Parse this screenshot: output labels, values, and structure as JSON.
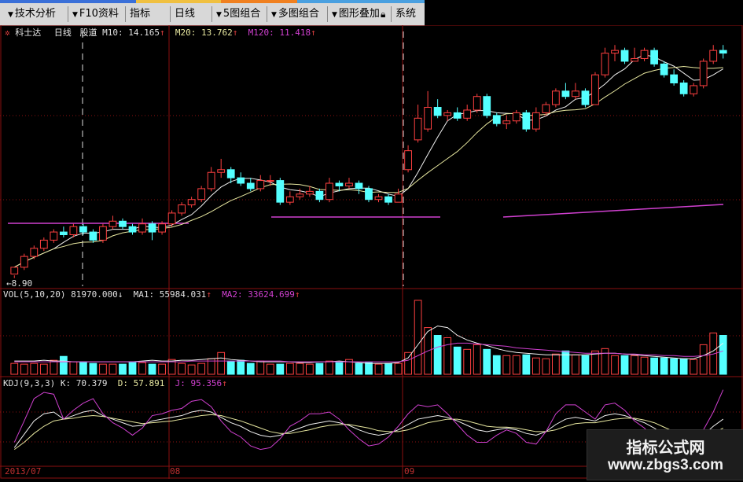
{
  "toolbar": {
    "items": [
      {
        "label": "技术分析",
        "dropdown": true
      },
      {
        "label": "F10资料",
        "dropdown": true
      },
      {
        "label": "指标",
        "dropdown": false
      },
      {
        "label": "日线",
        "dropdown": false
      },
      {
        "label": "5图组合",
        "dropdown": true
      },
      {
        "label": "多图组合",
        "dropdown": true
      },
      {
        "label": "图形叠加",
        "dropdown": true
      },
      {
        "label": "系统",
        "dropdown": false
      }
    ],
    "lock_icon": "lock-icon"
  },
  "price_panel": {
    "stock_name": "科士达",
    "period": "日线",
    "indicator_name": "股道",
    "m10": "M10: 14.165",
    "m20": "M20: 13.762",
    "m120": "M120: 11.418",
    "low_label": "8.90",
    "arrows": "↑"
  },
  "vol_panel": {
    "label": "VOL(5,10,20)",
    "vol": "81970.000",
    "vol_arrow": "↓",
    "ma1": "MA1: 55984.031",
    "ma2": "MA2: 33624.699",
    "arrow_up": "↑"
  },
  "kdj_panel": {
    "label": "KDJ(9,3,3)",
    "k": "K: 70.379",
    "d": "D: 57.891",
    "j": "J: 95.356",
    "arrow_up": "↑"
  },
  "date_axis": [
    "2013/07",
    "08",
    "09"
  ],
  "watermark": {
    "line1": "指标公式网",
    "line2": "www.zbgs3.com"
  },
  "colors": {
    "up": "#ff4040",
    "down": "#54ffff",
    "ma_white": "#f0f0f0",
    "ma_yellow": "#e8e8a0",
    "ma_magenta": "#d040d0",
    "grid": "#8b1010"
  },
  "chart_data": {
    "type": "candlestick",
    "candles": [
      [
        9.05,
        9.3,
        9.0,
        8.9
      ],
      [
        9.3,
        9.7,
        9.8,
        9.2
      ],
      [
        9.7,
        10.0,
        10.1,
        9.6
      ],
      [
        10.0,
        10.3,
        10.4,
        9.9
      ],
      [
        10.3,
        10.6,
        10.7,
        10.2
      ],
      [
        10.6,
        10.5,
        10.8,
        10.4
      ],
      [
        10.5,
        10.8,
        10.9,
        10.4
      ],
      [
        10.8,
        10.6,
        10.9,
        10.5
      ],
      [
        10.6,
        10.3,
        10.7,
        10.2
      ],
      [
        10.3,
        10.8,
        10.9,
        10.2
      ],
      [
        10.8,
        11.0,
        11.2,
        10.7
      ],
      [
        11.0,
        10.8,
        11.1,
        10.7
      ],
      [
        10.8,
        10.6,
        10.9,
        10.5
      ],
      [
        10.6,
        10.9,
        11.1,
        10.5
      ],
      [
        10.9,
        10.6,
        11.0,
        10.3
      ],
      [
        10.6,
        10.9,
        11.0,
        10.5
      ],
      [
        10.9,
        11.3,
        11.4,
        10.8
      ],
      [
        11.3,
        11.6,
        11.7,
        11.2
      ],
      [
        11.6,
        11.8,
        11.9,
        11.5
      ],
      [
        11.8,
        12.2,
        12.3,
        11.7
      ],
      [
        12.2,
        12.8,
        13.0,
        12.1
      ],
      [
        12.8,
        12.9,
        13.3,
        12.6
      ],
      [
        12.9,
        12.6,
        13.0,
        12.4
      ],
      [
        12.6,
        12.4,
        12.8,
        12.3
      ],
      [
        12.4,
        12.2,
        12.6,
        12.1
      ],
      [
        12.2,
        12.5,
        12.7,
        12.1
      ],
      [
        12.5,
        12.5,
        12.7,
        12.3
      ],
      [
        12.5,
        11.7,
        12.6,
        11.6
      ],
      [
        11.7,
        11.9,
        12.1,
        11.6
      ],
      [
        11.9,
        12.0,
        12.2,
        11.8
      ],
      [
        12.0,
        12.1,
        12.3,
        11.9
      ],
      [
        12.1,
        11.8,
        12.2,
        11.7
      ],
      [
        11.8,
        12.4,
        12.6,
        11.7
      ],
      [
        12.4,
        12.3,
        12.5,
        12.1
      ],
      [
        12.3,
        12.4,
        12.6,
        12.2
      ],
      [
        12.4,
        12.2,
        12.5,
        12.0
      ],
      [
        12.2,
        11.8,
        12.3,
        11.7
      ],
      [
        11.8,
        11.9,
        12.0,
        11.7
      ],
      [
        11.9,
        11.7,
        12.0,
        11.6
      ],
      [
        11.7,
        12.0,
        12.2,
        11.7
      ],
      [
        12.9,
        13.6,
        13.8,
        12.8
      ],
      [
        14.0,
        14.8,
        15.3,
        13.9
      ],
      [
        14.4,
        15.2,
        15.8,
        14.3
      ],
      [
        15.2,
        14.9,
        15.5,
        14.8
      ],
      [
        14.9,
        15.0,
        15.1,
        14.7
      ],
      [
        15.0,
        14.8,
        15.2,
        14.7
      ],
      [
        14.8,
        15.1,
        15.3,
        14.7
      ],
      [
        15.1,
        15.6,
        15.7,
        15.0
      ],
      [
        15.6,
        14.9,
        15.7,
        14.8
      ],
      [
        14.9,
        14.6,
        15.0,
        14.5
      ],
      [
        14.6,
        14.7,
        14.9,
        14.4
      ],
      [
        14.7,
        15.0,
        15.1,
        14.6
      ],
      [
        15.0,
        14.4,
        15.1,
        14.3
      ],
      [
        14.4,
        15.0,
        15.2,
        14.3
      ],
      [
        15.0,
        15.3,
        15.4,
        14.9
      ],
      [
        15.3,
        15.8,
        15.9,
        15.2
      ],
      [
        15.8,
        15.6,
        16.1,
        15.5
      ],
      [
        15.6,
        15.8,
        16.1,
        15.5
      ],
      [
        15.8,
        15.3,
        15.9,
        15.2
      ],
      [
        15.3,
        16.4,
        16.5,
        15.3
      ],
      [
        16.4,
        17.2,
        17.4,
        16.3
      ],
      [
        17.2,
        17.3,
        17.5,
        16.9
      ],
      [
        17.3,
        16.9,
        17.4,
        16.8
      ],
      [
        16.9,
        17.0,
        17.4,
        16.9
      ],
      [
        17.0,
        17.3,
        17.4,
        16.9
      ],
      [
        17.3,
        16.8,
        17.4,
        16.7
      ],
      [
        16.8,
        16.4,
        16.9,
        16.3
      ],
      [
        16.4,
        16.1,
        16.6,
        16.0
      ],
      [
        16.1,
        15.7,
        16.2,
        15.6
      ],
      [
        15.7,
        16.0,
        16.1,
        15.6
      ],
      [
        16.0,
        16.9,
        17.0,
        15.9
      ],
      [
        16.9,
        17.3,
        17.5,
        16.8
      ],
      [
        17.3,
        17.2,
        17.5,
        17.0
      ]
    ],
    "volume": [
      14,
      13,
      14,
      13,
      18,
      23,
      16,
      16,
      14,
      13,
      13,
      13,
      16,
      15,
      13,
      13,
      19,
      14,
      12,
      14,
      20,
      28,
      17,
      18,
      14,
      17,
      13,
      13,
      14,
      14,
      13,
      14,
      17,
      15,
      19,
      14,
      15,
      13,
      14,
      14,
      28,
      95,
      60,
      50,
      47,
      35,
      32,
      38,
      32,
      24,
      24,
      24,
      25,
      21,
      20,
      26,
      30,
      25,
      24,
      30,
      33,
      24,
      24,
      24,
      22,
      21,
      21,
      20,
      20,
      19,
      38,
      53,
      50
    ],
    "ma_vol1": [
      17,
      17,
      17,
      18,
      17,
      17,
      16,
      16,
      16,
      16,
      16,
      16,
      16,
      17,
      18,
      17,
      17,
      18,
      18,
      19,
      20,
      21,
      19,
      18,
      17,
      16,
      16,
      16,
      16,
      15,
      15,
      16,
      16,
      17,
      16,
      15,
      14,
      14,
      14,
      15,
      21,
      38,
      55,
      62,
      60,
      50,
      44,
      40,
      37,
      33,
      30,
      28,
      27,
      26,
      25,
      25,
      25,
      25,
      25,
      26,
      27,
      27,
      26,
      25,
      24,
      23,
      22,
      21,
      20,
      20,
      24,
      30,
      40
    ],
    "ma_vol2": [
      16,
      16,
      16,
      16,
      16,
      16,
      16,
      16,
      16,
      16,
      16,
      16,
      16,
      16,
      16,
      16,
      16,
      16,
      17,
      17,
      17,
      17,
      17,
      17,
      17,
      17,
      17,
      17,
      16,
      16,
      16,
      16,
      16,
      16,
      16,
      16,
      16,
      16,
      16,
      16,
      18,
      24,
      30,
      35,
      38,
      40,
      40,
      39,
      38,
      37,
      36,
      34,
      33,
      32,
      31,
      30,
      29,
      28,
      27,
      27,
      27,
      27,
      26,
      26,
      25,
      25,
      24,
      24,
      23,
      23,
      24,
      26,
      30
    ],
    "kdj_k": [
      30,
      45,
      60,
      68,
      70,
      62,
      66,
      70,
      72,
      66,
      62,
      58,
      54,
      55,
      60,
      62,
      64,
      66,
      70,
      72,
      70,
      64,
      58,
      54,
      48,
      44,
      42,
      44,
      48,
      52,
      56,
      58,
      60,
      58,
      55,
      50,
      46,
      44,
      46,
      50,
      56,
      62,
      64,
      66,
      64,
      60,
      55,
      50,
      48,
      50,
      52,
      50,
      46,
      44,
      48,
      56,
      62,
      64,
      62,
      60,
      66,
      68,
      66,
      62,
      58,
      52,
      44,
      38,
      34,
      36,
      44,
      54,
      62
    ],
    "kdj_d": [
      28,
      36,
      46,
      54,
      60,
      62,
      63,
      65,
      66,
      65,
      63,
      61,
      59,
      57,
      58,
      59,
      60,
      62,
      64,
      66,
      67,
      66,
      63,
      60,
      56,
      52,
      48,
      46,
      46,
      48,
      50,
      53,
      55,
      56,
      56,
      54,
      52,
      49,
      48,
      48,
      50,
      54,
      58,
      60,
      62,
      62,
      60,
      57,
      54,
      53,
      53,
      52,
      50,
      48,
      48,
      50,
      54,
      57,
      58,
      58,
      60,
      62,
      63,
      63,
      61,
      58,
      53,
      48,
      43,
      40,
      41,
      46,
      52
    ],
    "kdj_j": [
      36,
      60,
      85,
      92,
      90,
      62,
      72,
      80,
      85,
      68,
      58,
      52,
      44,
      52,
      66,
      68,
      72,
      74,
      82,
      84,
      76,
      60,
      48,
      42,
      32,
      28,
      30,
      40,
      54,
      60,
      68,
      68,
      70,
      62,
      50,
      40,
      32,
      34,
      42,
      54,
      68,
      78,
      76,
      78,
      68,
      56,
      44,
      36,
      36,
      44,
      50,
      46,
      36,
      34,
      48,
      68,
      78,
      78,
      70,
      62,
      78,
      80,
      72,
      60,
      52,
      40,
      26,
      20,
      16,
      28,
      50,
      70,
      95
    ]
  }
}
